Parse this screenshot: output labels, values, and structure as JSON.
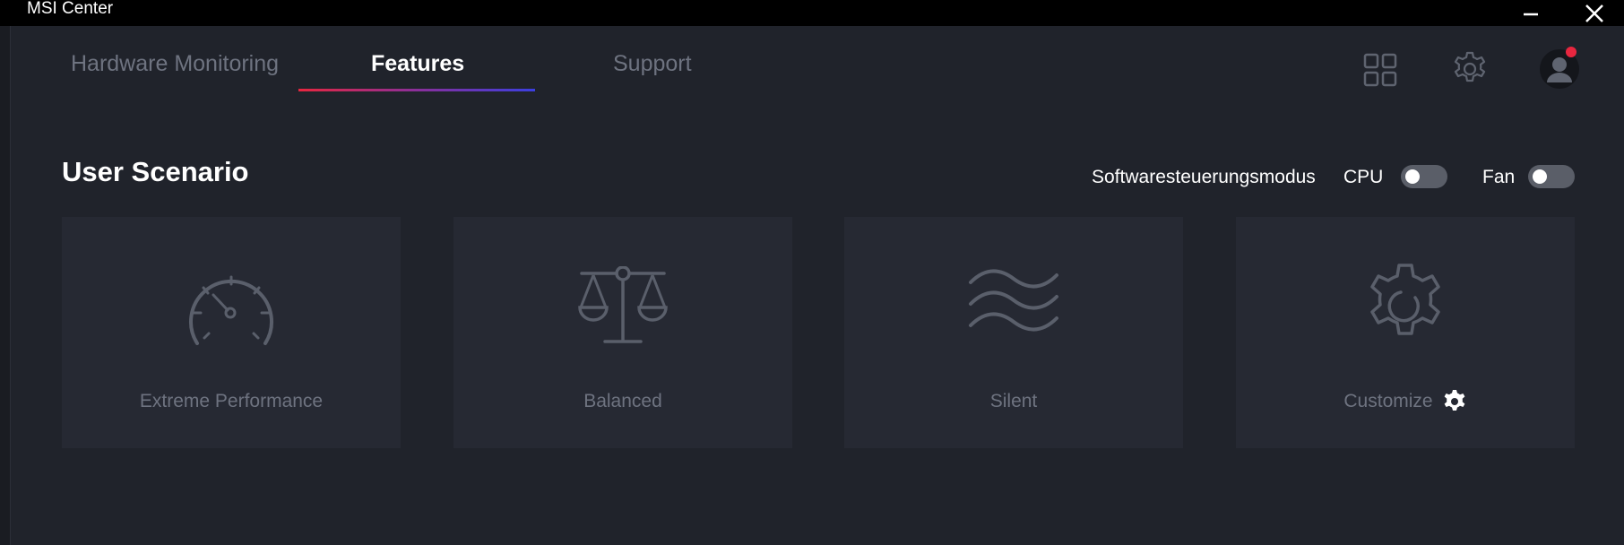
{
  "window": {
    "title": "MSI Center",
    "minimize_icon": "minimize-icon",
    "close_icon": "close-icon"
  },
  "nav": {
    "tabs": [
      {
        "label": "Hardware Monitoring",
        "active": false
      },
      {
        "label": "Features",
        "active": true
      },
      {
        "label": "Support",
        "active": false
      }
    ],
    "icons": [
      "grid-icon",
      "gear-icon",
      "user-avatar-icon"
    ],
    "accent_gradient": [
      "#e8263f",
      "#3b3fe0"
    ],
    "notification_color": "#e8263f"
  },
  "section": {
    "title": "User Scenario",
    "mode_label": "Softwaresteuerungsmodus",
    "cpu_label": "CPU",
    "cpu_enabled": false,
    "fan_label": "Fan",
    "fan_enabled": false
  },
  "scenarios": [
    {
      "label": "Extreme Performance",
      "icon": "speedometer-icon"
    },
    {
      "label": "Balanced",
      "icon": "balance-scale-icon"
    },
    {
      "label": "Silent",
      "icon": "waves-icon"
    },
    {
      "label": "Customize",
      "icon": "gear-icon",
      "settings_icon": "gear-icon"
    }
  ]
}
